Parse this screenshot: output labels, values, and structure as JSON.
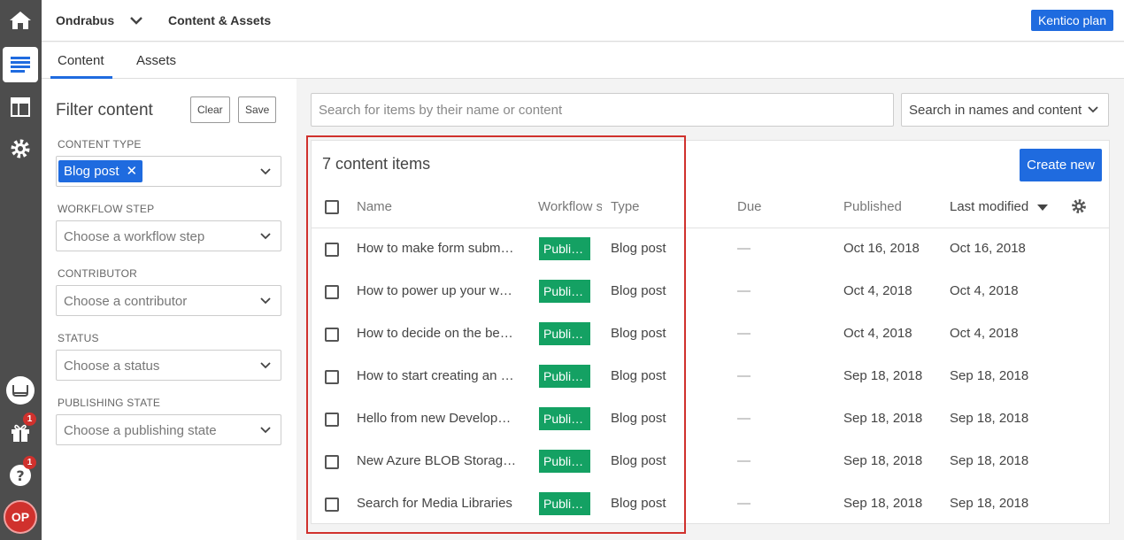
{
  "rail": {
    "items": [
      {
        "icon": "home-icon"
      },
      {
        "icon": "content-icon",
        "active": true
      },
      {
        "icon": "layout-icon"
      },
      {
        "icon": "gear-icon"
      }
    ],
    "bottom": {
      "feedback_icon": "chat-icon",
      "gift_badge": "1",
      "help_badge": "1",
      "avatar_initials": "OP"
    }
  },
  "topbar": {
    "project": "Ondrabus",
    "section": "Content & Assets",
    "plan_button": "Kentico plan"
  },
  "tabs": [
    {
      "label": "Content",
      "active": true
    },
    {
      "label": "Assets",
      "active": false
    }
  ],
  "filter": {
    "title": "Filter content",
    "clear_label": "Clear",
    "save_label": "Save",
    "content_type": {
      "label": "CONTENT TYPE",
      "selected": "Blog post"
    },
    "workflow": {
      "label": "WORKFLOW STEP",
      "placeholder": "Choose a workflow step"
    },
    "contributor": {
      "label": "CONTRIBUTOR",
      "placeholder": "Choose a contributor"
    },
    "status": {
      "label": "STATUS",
      "placeholder": "Choose a status"
    },
    "publishing": {
      "label": "PUBLISHING STATE",
      "placeholder": "Choose a publishing state"
    }
  },
  "search": {
    "placeholder": "Search for items by their name or content",
    "scope": "Search in names and content"
  },
  "list": {
    "count": "7 content items",
    "create_label": "Create new",
    "headers": {
      "name": "Name",
      "workflow": "Workflow s",
      "type": "Type",
      "due": "Due",
      "published": "Published",
      "modified": "Last modified"
    },
    "rows": [
      {
        "name": "How to make form subm…",
        "workflow": "Publi…",
        "type": "Blog post",
        "due": "—",
        "published": "Oct 16, 2018",
        "modified": "Oct 16, 2018"
      },
      {
        "name": "How to power up your w…",
        "workflow": "Publi…",
        "type": "Blog post",
        "due": "—",
        "published": "Oct 4, 2018",
        "modified": "Oct 4, 2018"
      },
      {
        "name": "How to decide on the be…",
        "workflow": "Publi…",
        "type": "Blog post",
        "due": "—",
        "published": "Oct 4, 2018",
        "modified": "Oct 4, 2018"
      },
      {
        "name": "How to start creating an …",
        "workflow": "Publi…",
        "type": "Blog post",
        "due": "—",
        "published": "Sep 18, 2018",
        "modified": "Sep 18, 2018"
      },
      {
        "name": "Hello from new Develop…",
        "workflow": "Publi…",
        "type": "Blog post",
        "due": "—",
        "published": "Sep 18, 2018",
        "modified": "Sep 18, 2018"
      },
      {
        "name": "New Azure BLOB Storage…",
        "workflow": "Publi…",
        "type": "Blog post",
        "due": "—",
        "published": "Sep 18, 2018",
        "modified": "Sep 18, 2018"
      },
      {
        "name": "Search for Media Libraries",
        "workflow": "Publi…",
        "type": "Blog post",
        "due": "—",
        "published": "Sep 18, 2018",
        "modified": "Sep 18, 2018"
      }
    ]
  },
  "colors": {
    "accent": "#1f6bdf",
    "published_badge": "#14a163",
    "highlight": "#d0312d",
    "rail": "#4d4d4d"
  }
}
